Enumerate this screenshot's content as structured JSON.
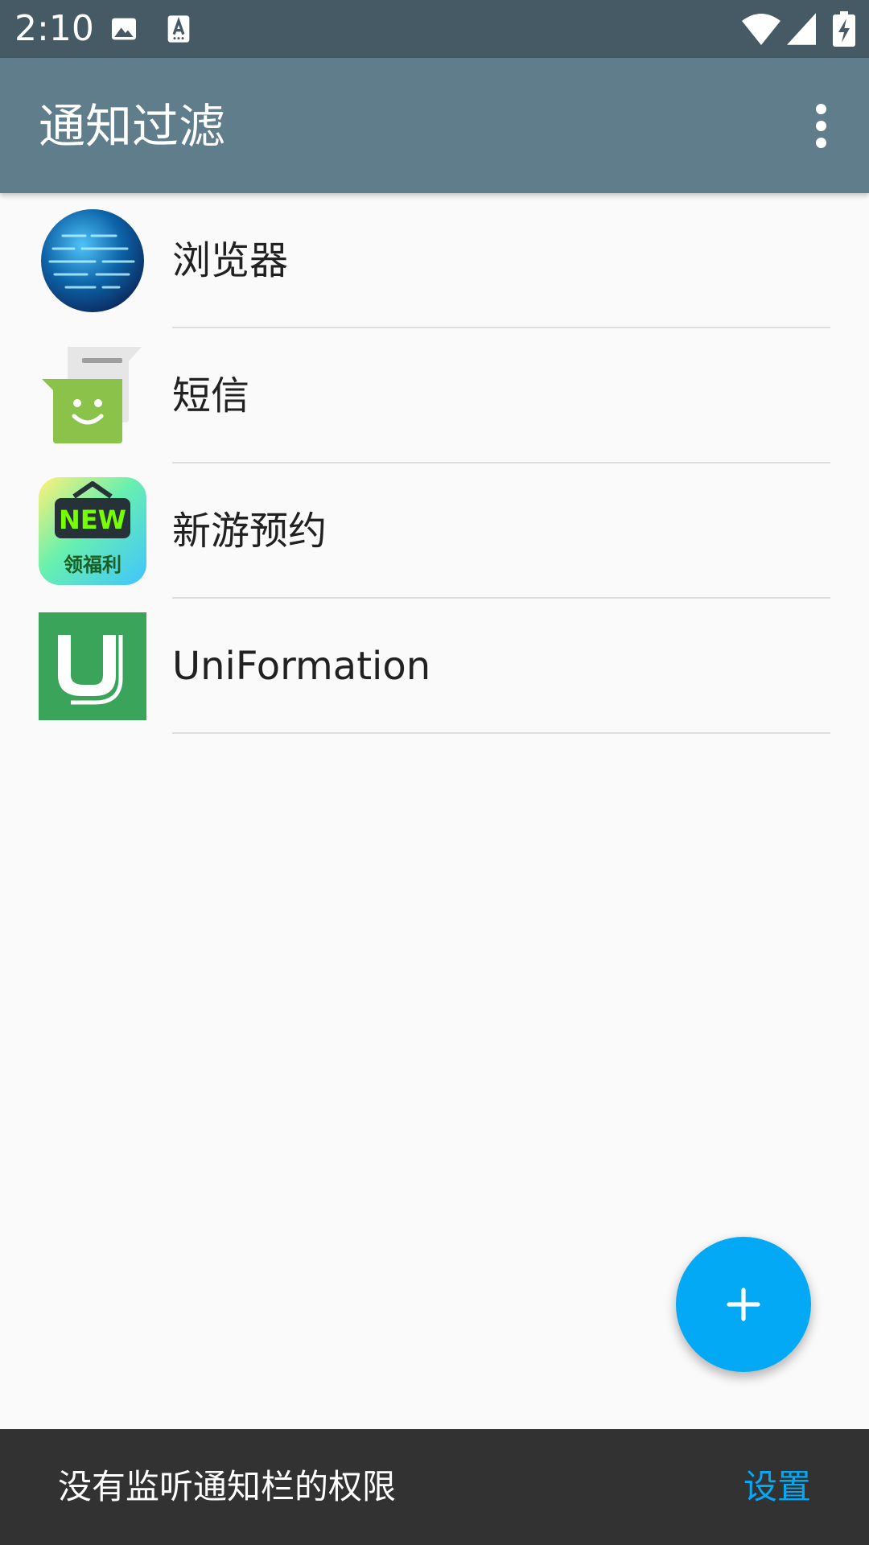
{
  "status_bar": {
    "time": "2:10",
    "icons": [
      "image-icon",
      "text-recognition-icon",
      "wifi-icon",
      "cell-signal-icon",
      "battery-charging-icon"
    ]
  },
  "app_bar": {
    "title": "通知过滤",
    "overflow_icon": "more-vert-icon"
  },
  "list": {
    "items": [
      {
        "label": "浏览器",
        "icon": "browser-globe-icon"
      },
      {
        "label": "短信",
        "icon": "messaging-icon"
      },
      {
        "label": "新游预约",
        "icon": "new-game-icon",
        "icon_text_top": "NEW",
        "icon_text_bottom": "领福利"
      },
      {
        "label": "UniFormation",
        "icon": "uniformation-icon"
      }
    ]
  },
  "fab": {
    "icon": "plus-icon"
  },
  "snackbar": {
    "message": "没有监听通知栏的权限",
    "action": "设置"
  },
  "colors": {
    "status_bar": "#455a64",
    "app_bar": "#607d8b",
    "accent": "#03a9f4",
    "snackbar": "#323232",
    "background": "#fafafa"
  }
}
